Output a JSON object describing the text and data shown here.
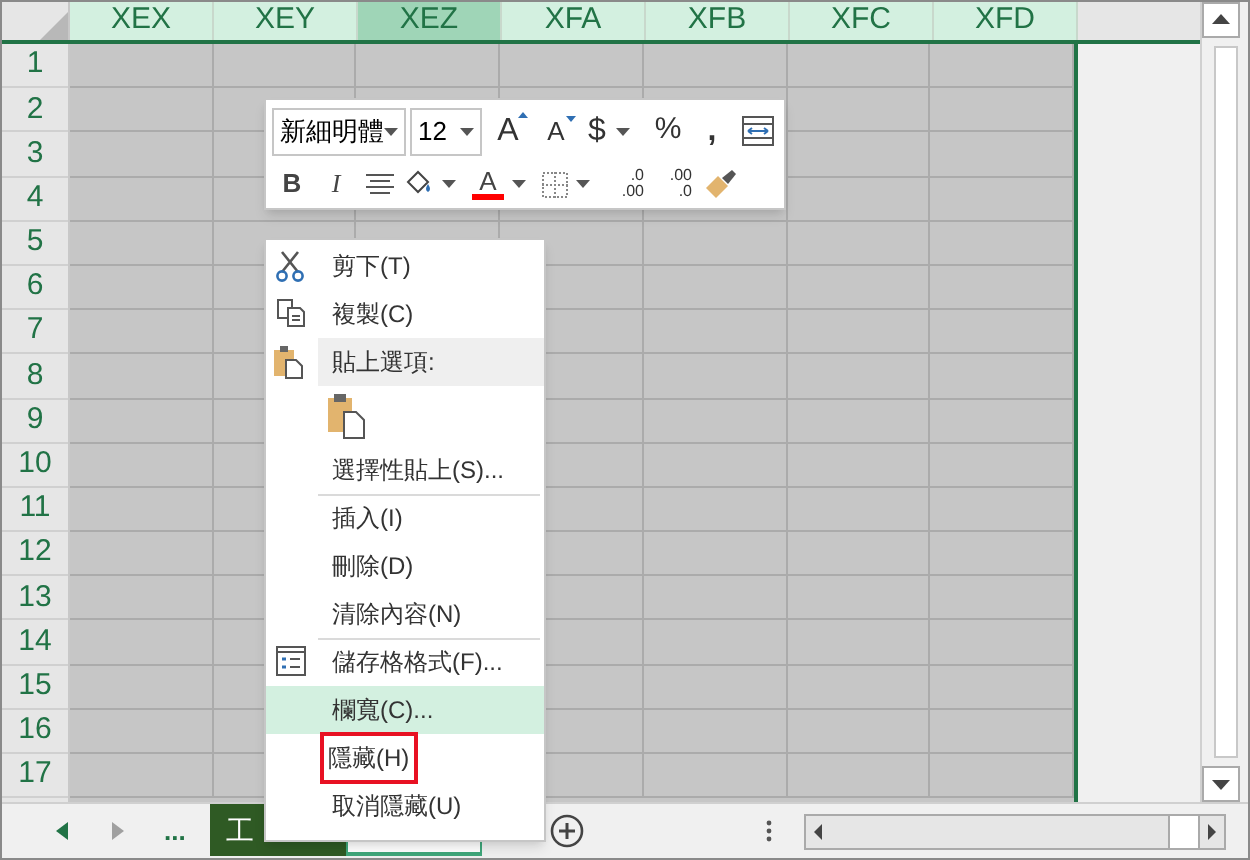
{
  "columns": [
    {
      "label": "XEX",
      "selected": false
    },
    {
      "label": "XEY",
      "selected": false
    },
    {
      "label": "XEZ",
      "selected": true
    },
    {
      "label": "XFA",
      "selected": false
    },
    {
      "label": "XFB",
      "selected": false
    },
    {
      "label": "XFC",
      "selected": false
    },
    {
      "label": "XFD",
      "selected": false
    }
  ],
  "rows": [
    "1",
    "2",
    "3",
    "4",
    "5",
    "6",
    "7",
    "8",
    "9",
    "10",
    "11",
    "12",
    "13",
    "14",
    "15",
    "16",
    "17"
  ],
  "mini_toolbar": {
    "font": "新細明體",
    "size": "12",
    "grow": "A",
    "shrink": "A",
    "currency": "$",
    "percent": "%",
    "comma": ",",
    "bold": "B",
    "italic": "I",
    "font_color": "A",
    "increase_decimal": [
      ".0",
      ".00"
    ],
    "decrease_decimal": [
      ".00",
      ".0"
    ]
  },
  "context_menu": [
    {
      "kind": "cut",
      "label": "剪下(T)",
      "selected": false,
      "outlined": false,
      "separator_before": false
    },
    {
      "kind": "copy",
      "label": "複製(C)",
      "selected": false,
      "outlined": false,
      "separator_before": false
    },
    {
      "kind": "header",
      "label": "貼上選項:",
      "selected": false,
      "outlined": false,
      "separator_before": false
    },
    {
      "kind": "paste"
    },
    {
      "kind": "plain",
      "label": "選擇性貼上(S)...",
      "selected": false,
      "outlined": false,
      "separator_before": false
    },
    {
      "kind": "plain",
      "label": "插入(I)",
      "selected": false,
      "outlined": false,
      "separator_before": true
    },
    {
      "kind": "plain",
      "label": "刪除(D)",
      "selected": false,
      "outlined": false,
      "separator_before": false
    },
    {
      "kind": "plain",
      "label": "清除內容(N)",
      "selected": false,
      "outlined": false,
      "separator_before": false
    },
    {
      "kind": "format",
      "label": "儲存格格式(F)...",
      "selected": false,
      "outlined": false,
      "separator_before": true
    },
    {
      "kind": "plain",
      "label": "欄寬(C)...",
      "selected": true,
      "outlined": false,
      "separator_before": false
    },
    {
      "kind": "plain",
      "label": "隱藏(H)",
      "selected": false,
      "outlined": true,
      "separator_before": false
    },
    {
      "kind": "plain",
      "label": "取消隱藏(U)",
      "selected": false,
      "outlined": false,
      "separator_before": false
    }
  ],
  "sheet_bar": {
    "more": "...",
    "tabs": [
      {
        "label": "工",
        "selected": false,
        "highlighted": true
      },
      {
        "selected": true,
        "highlighted": false
      }
    ]
  }
}
